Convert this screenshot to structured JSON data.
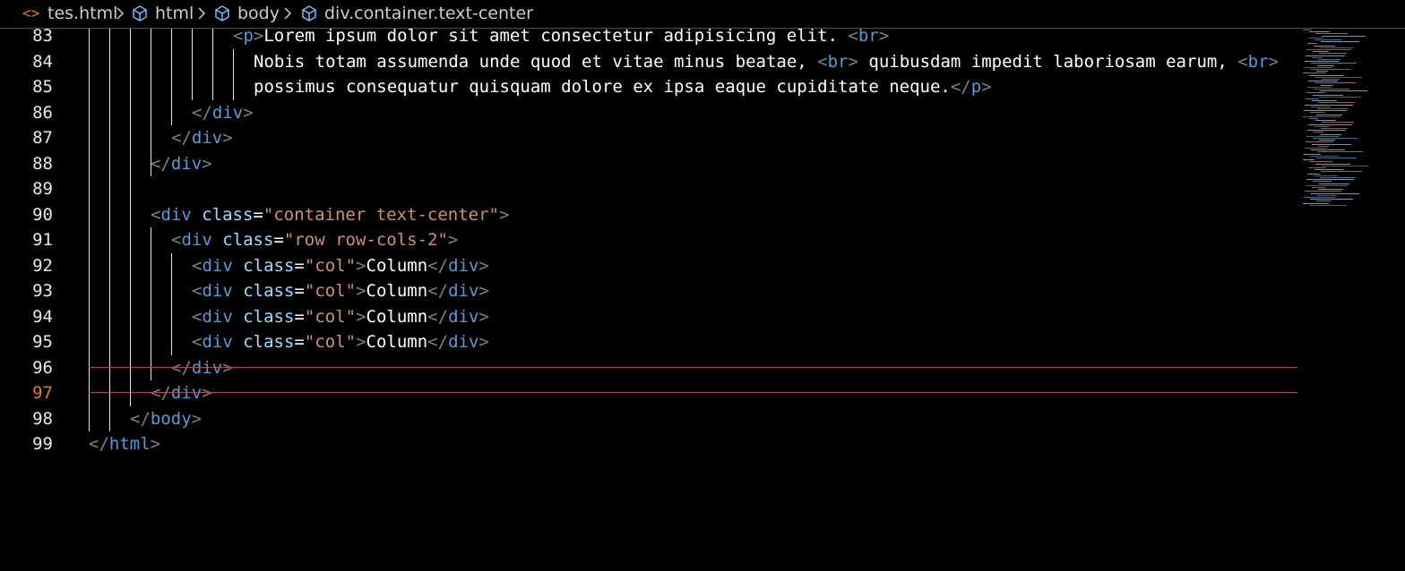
{
  "breadcrumb": {
    "items": [
      {
        "label": "tes.html",
        "icon": "html-file-icon"
      },
      {
        "label": "html",
        "icon": "element-cube-icon"
      },
      {
        "label": "body",
        "icon": "element-cube-icon"
      },
      {
        "label": "div.container.text-center",
        "icon": "element-cube-icon"
      }
    ],
    "file_icon_glyph": "<>"
  },
  "colors": {
    "background": "#000000",
    "tag": "#569cd6",
    "attribute": "#9cdcfe",
    "string": "#ce9178",
    "bracket": "#808080",
    "text": "#ffffff",
    "active_line_number": "#e37933",
    "current_line_border": "#b04a3c"
  },
  "editor": {
    "active_line": 97,
    "lines": [
      {
        "number": 83,
        "text": "<p>Lorem ipsum dolor sit amet consectetur adipisicing elit. <br>"
      },
      {
        "number": 84,
        "text": "Nobis totam assumenda unde quod et vitae minus beatae, <br> quibusdam impedit laboriosam earum, <br>"
      },
      {
        "number": 85,
        "text": "possimus consequatur quisquam dolore ex ipsa eaque cupiditate neque.</p>"
      },
      {
        "number": 86,
        "text": "</div>"
      },
      {
        "number": 87,
        "text": "</div>"
      },
      {
        "number": 88,
        "text": "</div>"
      },
      {
        "number": 89,
        "text": ""
      },
      {
        "number": 90,
        "text": "<div class=\"container text-center\">"
      },
      {
        "number": 91,
        "text": "<div class=\"row row-cols-2\">"
      },
      {
        "number": 92,
        "text": "<div class=\"col\">Column</div>"
      },
      {
        "number": 93,
        "text": "<div class=\"col\">Column</div>"
      },
      {
        "number": 94,
        "text": "<div class=\"col\">Column</div>"
      },
      {
        "number": 95,
        "text": "<div class=\"col\">Column</div>"
      },
      {
        "number": 96,
        "text": "</div>"
      },
      {
        "number": 97,
        "text": "</div>"
      },
      {
        "number": 98,
        "text": "</body>"
      },
      {
        "number": 99,
        "text": "</html>"
      }
    ]
  }
}
